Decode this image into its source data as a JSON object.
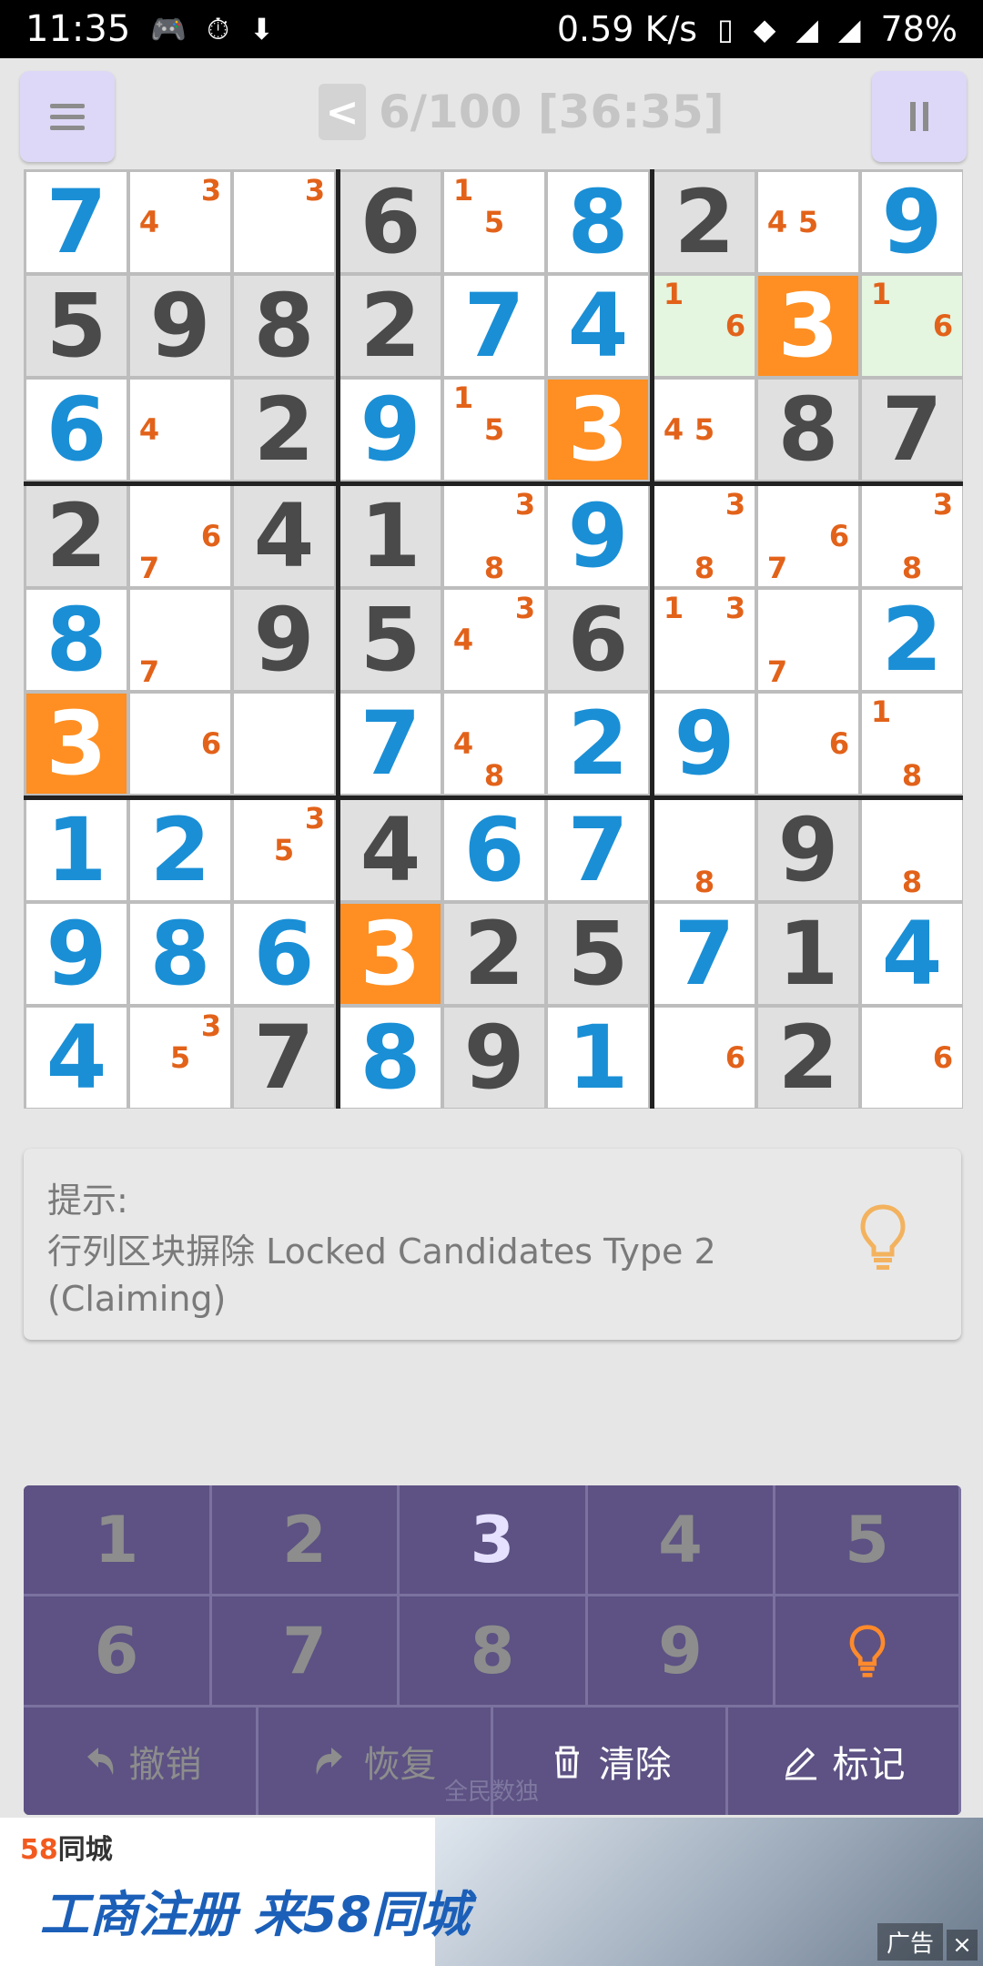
{
  "status_bar": {
    "time": "11:35",
    "net_speed": "0.59 K/s",
    "battery": "78%",
    "icons": [
      "gamepad-icon",
      "timer-icon",
      "download-icon",
      "phone-icon",
      "wifi-icon",
      "signal-icon",
      "signal-4g-icon"
    ]
  },
  "header": {
    "prev_label": "<",
    "title": "6/100 [36:35]",
    "menu_icon": "menu-icon",
    "pause_icon": "pause-icon"
  },
  "board": {
    "cells": [
      [
        "u7",
        "c4,3",
        "c3",
        "g6",
        "c1,5",
        "u8",
        "g2",
        "c4,5",
        "u9"
      ],
      [
        "g5",
        "g9",
        "g8",
        "g2",
        "u7",
        "u4",
        "c1,6",
        "h3",
        "c1,6"
      ],
      [
        "u6",
        "c4",
        "g2",
        "u9",
        "c1,5",
        "h3",
        "c4,5",
        "g8",
        "g7"
      ],
      [
        "g2",
        "c6,7",
        "g4",
        "g1",
        "c3,8",
        "u9",
        "c3,8",
        "c6,7",
        "c3,8"
      ],
      [
        "u8",
        "c7",
        "g9",
        "g5",
        "c3,4",
        "g6",
        "c1,3",
        "c7",
        "u2"
      ],
      [
        "h3",
        "c6",
        "",
        "u7",
        "c4,8",
        "u2",
        "u9",
        "c6",
        "c1,8"
      ],
      [
        "u1",
        "u2",
        "c3,5",
        "g4",
        "u6",
        "u7",
        "c8",
        "g9",
        "c8"
      ],
      [
        "u9",
        "u8",
        "u6",
        "h3",
        "g2",
        "g5",
        "u7",
        "g1",
        "u4"
      ],
      [
        "u4",
        "c3,5",
        "g7",
        "u8",
        "g9",
        "u1",
        "c6",
        "g2",
        "c6"
      ]
    ],
    "shade": [
      [
        0,
        0,
        0,
        1,
        0,
        0,
        1,
        0,
        0
      ],
      [
        1,
        1,
        1,
        1,
        0,
        0,
        2,
        0,
        2
      ],
      [
        0,
        0,
        1,
        0,
        0,
        0,
        0,
        1,
        1
      ],
      [
        1,
        0,
        1,
        1,
        0,
        0,
        0,
        0,
        0
      ],
      [
        0,
        0,
        1,
        1,
        0,
        1,
        0,
        0,
        0
      ],
      [
        0,
        0,
        0,
        0,
        0,
        0,
        0,
        0,
        0
      ],
      [
        0,
        0,
        0,
        1,
        0,
        0,
        0,
        1,
        0
      ],
      [
        0,
        0,
        0,
        0,
        1,
        1,
        0,
        1,
        0
      ],
      [
        0,
        0,
        1,
        0,
        1,
        0,
        0,
        1,
        0
      ]
    ],
    "colors": {
      "given": "#4a4a4a",
      "user": "#1a8fd6",
      "candidate": "#e2621a",
      "highlight": "#ff8f22",
      "shaded": "#e0e0e0",
      "peer": "#e4f5e0"
    }
  },
  "hint": {
    "title": "提示:",
    "text": "行列区块摒除 Locked Candidates Type 2 (Claiming)",
    "icon": "lightbulb-icon"
  },
  "keypad": {
    "keys": [
      "1",
      "2",
      "3",
      "4",
      "5",
      "6",
      "7",
      "8",
      "9"
    ],
    "active_key": "3",
    "hint_key_icon": "lightbulb-icon",
    "actions": [
      {
        "label": "撤销",
        "icon": "undo-icon",
        "enabled": false
      },
      {
        "label": "恢复",
        "icon": "redo-icon",
        "enabled": false
      },
      {
        "label": "清除",
        "icon": "trash-icon",
        "enabled": true
      },
      {
        "label": "标记",
        "icon": "pencil-icon",
        "enabled": true
      }
    ],
    "watermark": "全民数独"
  },
  "ad": {
    "brand_num": "58",
    "brand_text": "同城",
    "headline": "工商注册 来58同城",
    "tag": "广告",
    "close": "×"
  }
}
